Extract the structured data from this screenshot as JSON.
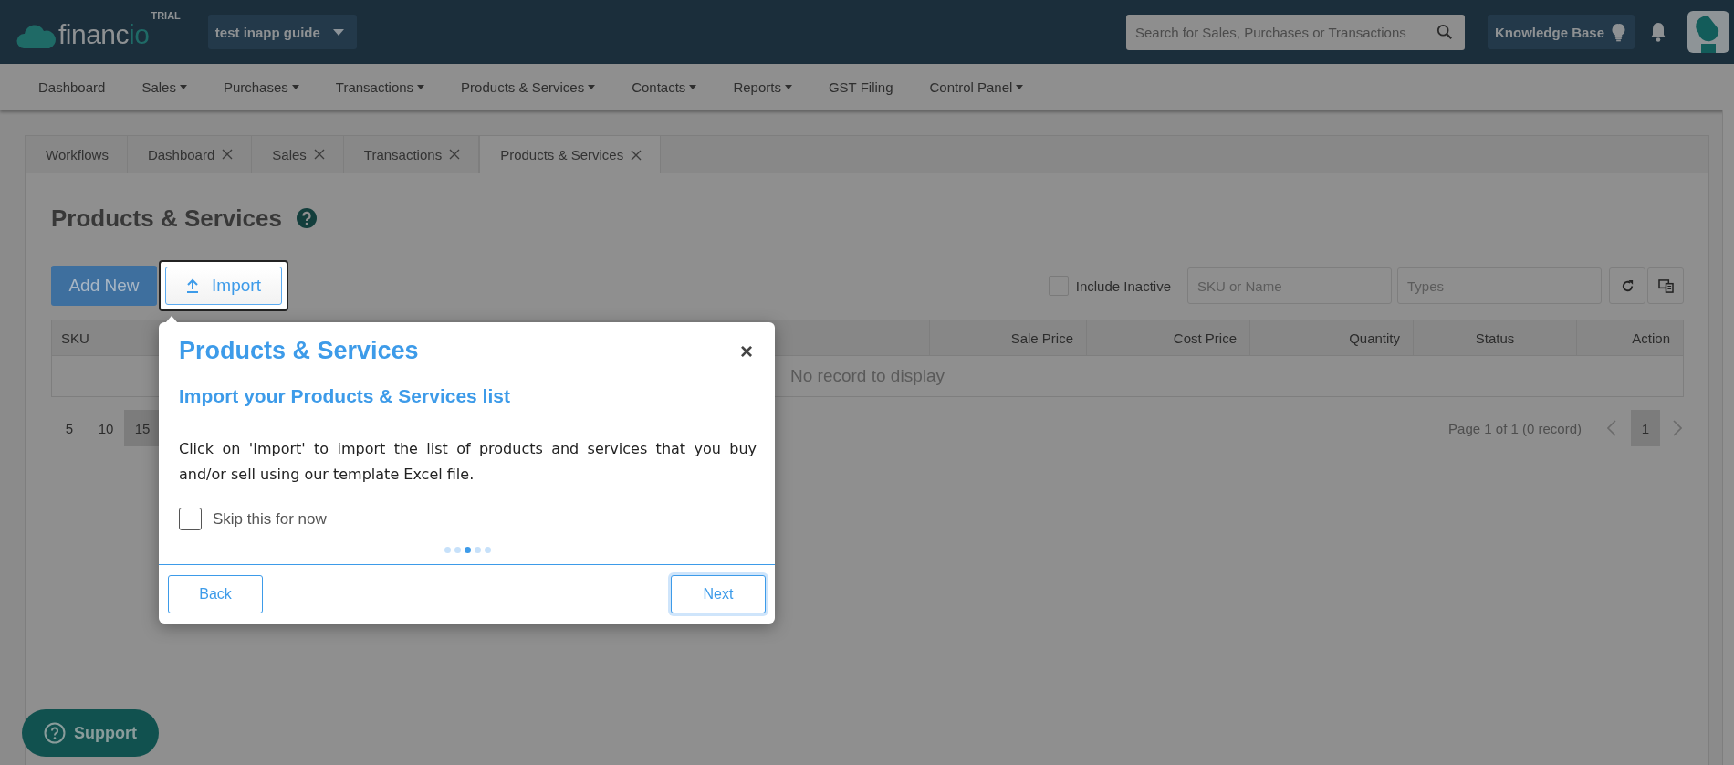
{
  "header": {
    "logo_main": "financ",
    "logo_accent": "io",
    "badge": "TRIAL",
    "company": "test inapp guide",
    "search": {
      "placeholder": "Search for Sales, Purchases or Transactions"
    },
    "knowledge_base": "Knowledge Base"
  },
  "nav": [
    {
      "label": "Dashboard",
      "has_menu": false
    },
    {
      "label": "Sales",
      "has_menu": true
    },
    {
      "label": "Purchases",
      "has_menu": true
    },
    {
      "label": "Transactions",
      "has_menu": true
    },
    {
      "label": "Products & Services",
      "has_menu": true
    },
    {
      "label": "Contacts",
      "has_menu": true
    },
    {
      "label": "Reports",
      "has_menu": true
    },
    {
      "label": "GST Filing",
      "has_menu": false
    },
    {
      "label": "Control Panel",
      "has_menu": true
    }
  ],
  "tabs": [
    {
      "label": "Workflows",
      "closable": false,
      "selected": false
    },
    {
      "label": "Dashboard",
      "closable": true,
      "selected": false
    },
    {
      "label": "Sales",
      "closable": true,
      "selected": false
    },
    {
      "label": "Transactions",
      "closable": true,
      "selected": false
    },
    {
      "label": "Products & Services",
      "closable": true,
      "selected": true
    }
  ],
  "page": {
    "title": "Products & Services",
    "add_button": "Add New",
    "import_button": "Import",
    "include_inactive": {
      "label": "Include Inactive",
      "checked": false
    },
    "filters": [
      {
        "placeholder": "SKU or Name"
      },
      {
        "placeholder": "Types"
      }
    ]
  },
  "table": {
    "columns": [
      {
        "label": "SKU"
      },
      {
        "label": "Sale Price"
      },
      {
        "label": "Cost Price"
      },
      {
        "label": "Quantity"
      },
      {
        "label": "Status"
      },
      {
        "label": "Action"
      }
    ],
    "empty_message": "No record to display"
  },
  "page_sizes": [
    {
      "label": "5",
      "selected": false
    },
    {
      "label": "10",
      "selected": false
    },
    {
      "label": "15",
      "selected": true
    }
  ],
  "pagination": {
    "summary": "Page 1 of 1 (0 record)",
    "pages": [
      {
        "label": "1",
        "selected": true
      }
    ]
  },
  "guide": {
    "title": "Products & Services",
    "close": "×",
    "subtitle": "Import your Products & Services list",
    "body": "Click on 'Import' to import the list of products and services that you buy and/or sell using our template Excel file.",
    "skip": {
      "label": "Skip this for now",
      "checked": false
    },
    "steps": [
      {
        "selected": false
      },
      {
        "selected": false
      },
      {
        "selected": true
      },
      {
        "selected": false
      },
      {
        "selected": false
      }
    ],
    "back": "Back",
    "next": "Next"
  },
  "support": "Support"
}
